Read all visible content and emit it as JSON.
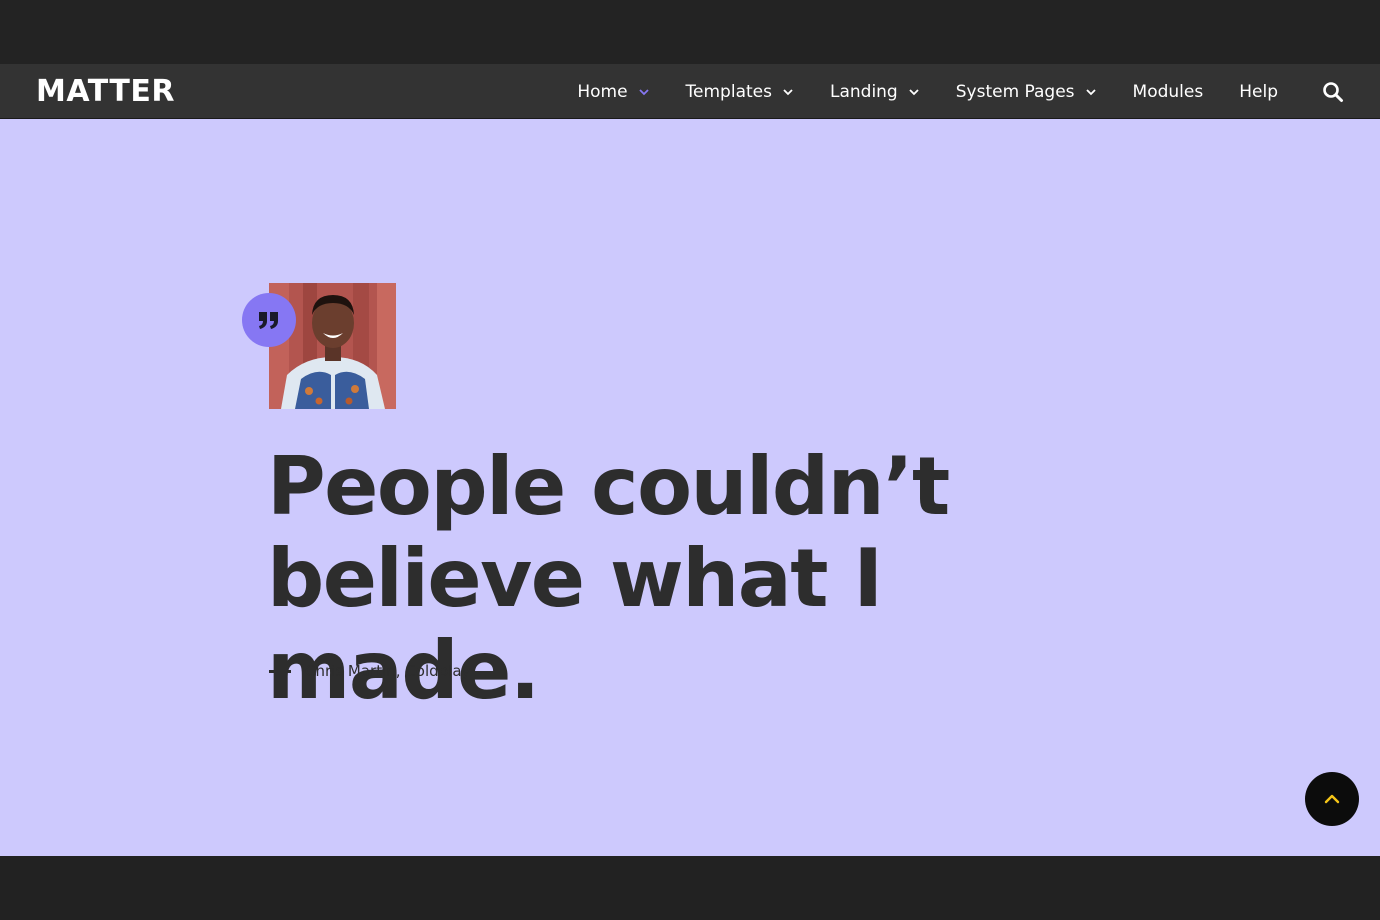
{
  "brand": {
    "logo": "MATTER"
  },
  "nav": {
    "items": [
      {
        "label": "Home",
        "dropdown": true,
        "active": true
      },
      {
        "label": "Templates",
        "dropdown": true
      },
      {
        "label": "Landing",
        "dropdown": true
      },
      {
        "label": "System Pages",
        "dropdown": true
      },
      {
        "label": "Modules",
        "dropdown": false
      },
      {
        "label": "Help",
        "dropdown": false
      }
    ],
    "search_icon": "search-icon"
  },
  "testimonial": {
    "quote_line1": "People couldn’t",
    "quote_line2": "believe what I made.",
    "author": "Chris Martin, Coldplay",
    "quote_icon": "quote-icon"
  },
  "back_to_top_icon": "chevron-up-icon",
  "colors": {
    "hero_bg": "#cdc9fd",
    "accent": "#8677f3",
    "nav_bg": "#333333",
    "text_dark": "#2d2d2d",
    "back_top_arrow": "#f5c518"
  }
}
